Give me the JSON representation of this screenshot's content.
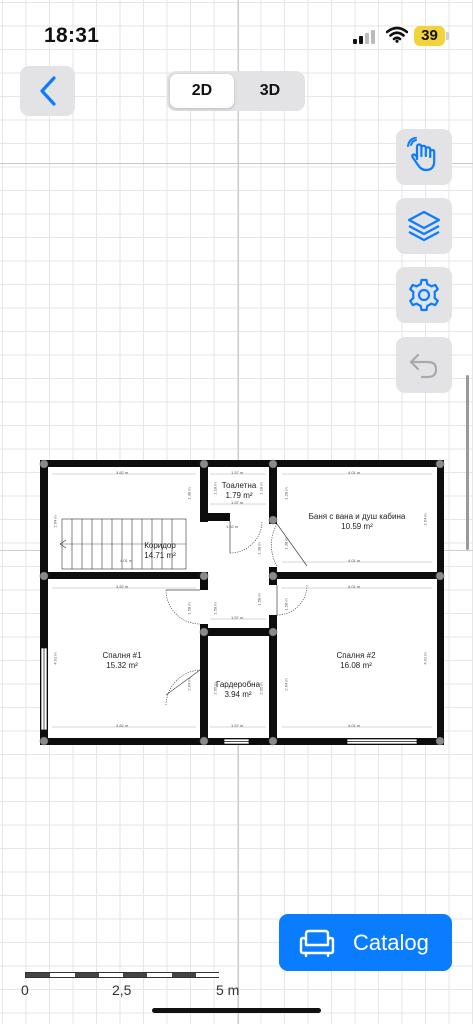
{
  "status_bar": {
    "time": "18:31",
    "battery_level": "39",
    "battery_color": "#f2d33c"
  },
  "view_toggle": {
    "options": [
      "2D",
      "3D"
    ],
    "selected": "2D"
  },
  "toolbar": {
    "back_icon": "chevron-left-icon",
    "tools": [
      {
        "name": "hand-icon"
      },
      {
        "name": "layers-icon"
      },
      {
        "name": "gear-icon"
      },
      {
        "name": "undo-icon",
        "disabled": true
      }
    ]
  },
  "floor_plan": {
    "rooms": [
      {
        "id": "toilet",
        "name": "Тоалетна",
        "area": "1.79 m²"
      },
      {
        "id": "bath",
        "name": "Баня с вана и душ кабина",
        "area": "10.59 m²"
      },
      {
        "id": "corridor",
        "name": "Коридор",
        "area": "14.71 m²"
      },
      {
        "id": "bedroom1",
        "name": "Спалня #1",
        "area": "15.32 m²"
      },
      {
        "id": "wardrobe",
        "name": "Гардеробна",
        "area": "3.94 m²"
      },
      {
        "id": "bedroom2",
        "name": "Спалня #2",
        "area": "16.08 m²"
      }
    ],
    "dimensions": {
      "top_left": "3.82 m",
      "top_mid": "1.57 m",
      "top_right": "4.01 m",
      "toilet_bottom": "1.57 m",
      "corridor_inner": "4.01 m",
      "corridor_wall": "3.82 m",
      "bath_bottom": "4.01 m",
      "bed2_top": "4.01 m",
      "mid_1": "1.57 m",
      "bed1_bottom": "3.82 m",
      "ward_bottom": "1.57 m",
      "bed2_bottom": "4.01 m",
      "corridor_small": "1.62 m",
      "v_stair": "2.64 m",
      "v_toilet": "1.38 m",
      "v_toilet2": "1.18 m",
      "v_bath": "1.28 m",
      "v_bath_right": "2.64 m",
      "v_corr1": "1.38 m",
      "v_corr2": "1.38 m",
      "v_bed1_left": "4.01 m",
      "v_bed1_inner": "2.64 m",
      "v_ward": "2.05 m",
      "v_bed2_left": "2.64 m",
      "v_bed2_right": "4.01 m",
      "v_corr3": "1.58 m",
      "v_corr4": "1.58 m",
      "v_corr5": "1.58 m"
    }
  },
  "catalog": {
    "label": "Catalog",
    "icon": "armchair-icon",
    "color": "#0a7cff"
  },
  "scale": {
    "labels": [
      "0",
      "2,5",
      "5 m"
    ]
  }
}
